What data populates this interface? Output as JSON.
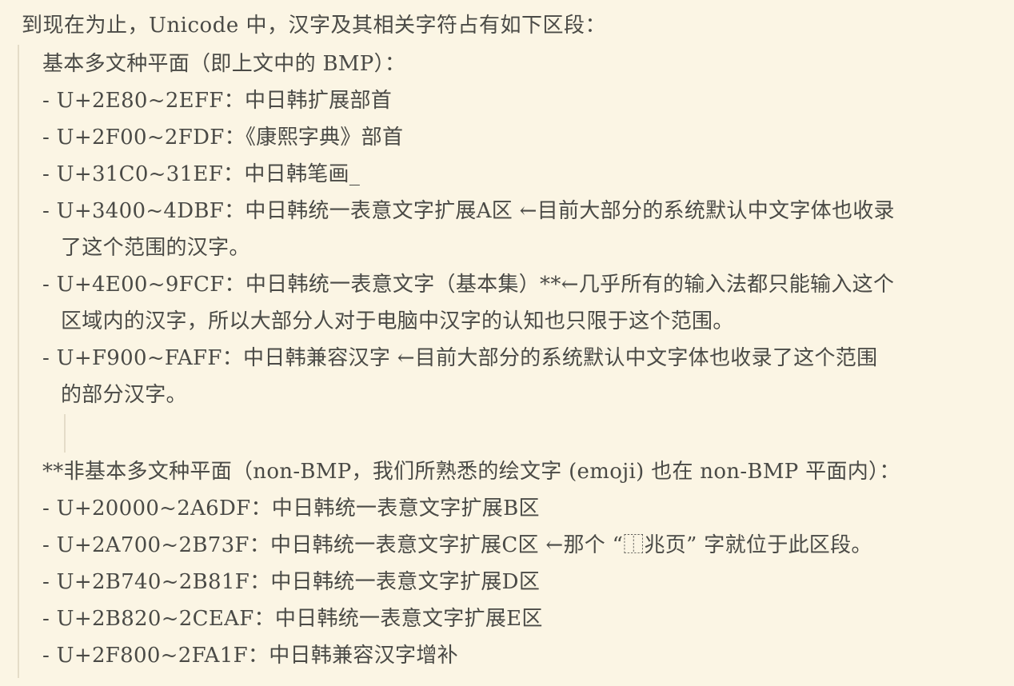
{
  "intro": "到现在为止，Unicode 中，汉字及其相关字符占有如下区段：",
  "bmp": {
    "heading": "基本多文种平面（即上文中的 BMP）：",
    "items": [
      "- U+2E80~2EFF：中日韩扩展部首",
      "- U+2F00~2FDF：《康熙字典》部首",
      "- U+31C0~31EF：中日韩笔画_",
      "- U+3400~4DBF：中日韩统一表意文字扩展A区 ←目前大部分的系统默认中文字体也收录",
      "了这个范围的汉字。",
      "- U+4E00~9FCF：中日韩统一表意文字（基本集）**←几乎所有的输入法都只能输入这个",
      "区域内的汉字，所以大部分人对于电脑中汉字的认知也只限于这个范围。",
      "- U+F900~FAFF：中日韩兼容汉字 ←目前大部分的系统默认中文字体也收录了这个范围",
      "的部分汉字。"
    ]
  },
  "non_bmp": {
    "heading": "**非基本多文种平面（non-BMP，我们所熟悉的绘文字 (emoji) 也在 non-BMP 平面内）：",
    "items": [
      "- U+20000~2A6DF：中日韩统一表意文字扩展B区",
      "- U+2A700~2B73F：中日韩统一表意文字扩展C区 ←那个 “⿰兆页” 字就位于此区段。",
      "- U+2B740~2B81F：中日韩统一表意文字扩展D区",
      "- U+2B820~2CEAF：中日韩统一表意文字扩展E区",
      "- U+2F800~2FA1F：中日韩兼容汉字增补"
    ]
  }
}
